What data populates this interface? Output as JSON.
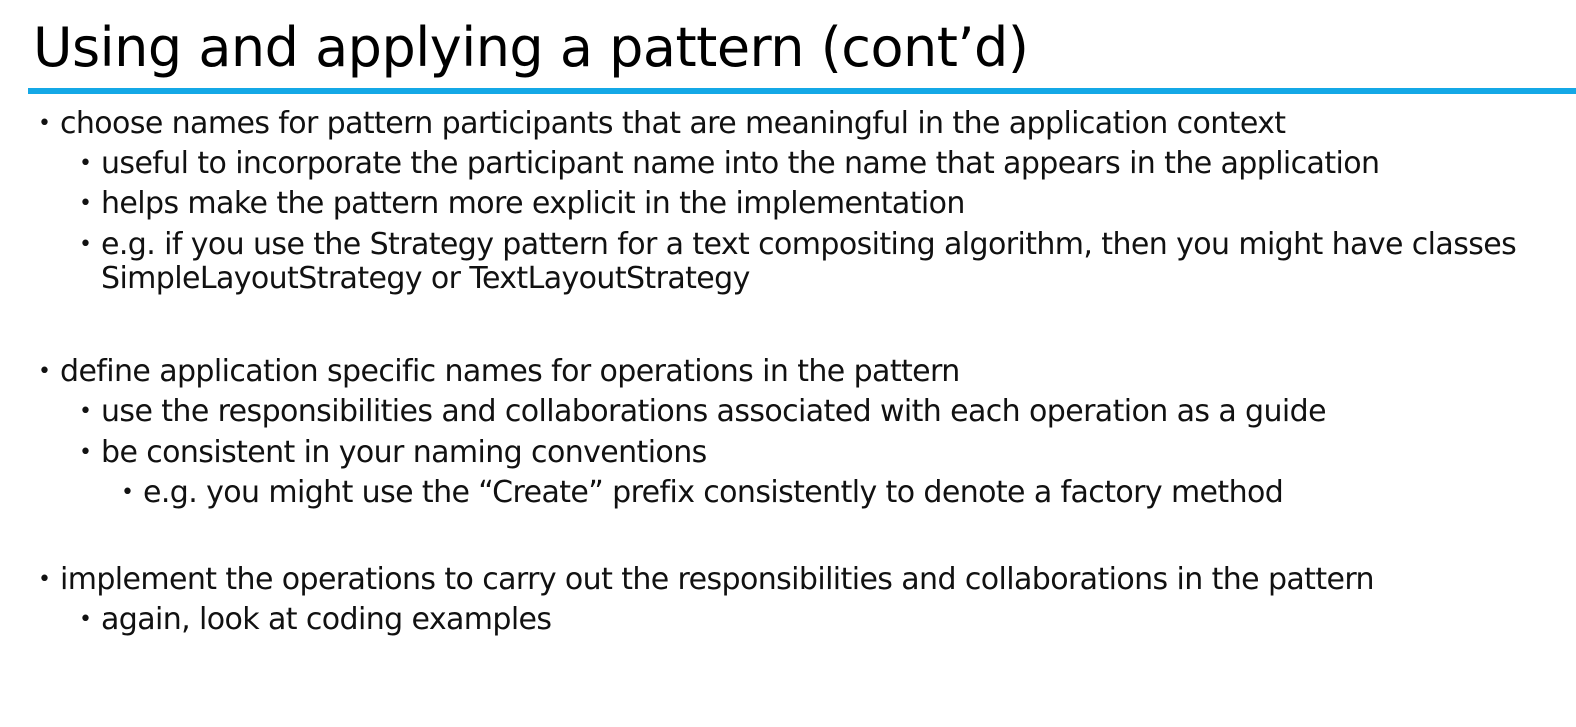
{
  "slide": {
    "title": "Using and applying a pattern (cont’d)",
    "accent_color": "#14a8e6"
  },
  "bullets": {
    "b1": "choose names for pattern participants that are meaningful in the application context",
    "b1_1": "useful to incorporate the participant name into the name that appears in the application",
    "b1_2": "helps make the pattern more explicit in the implementation",
    "b1_3_line1": "e.g.  if you use the Strategy pattern for a text compositing algorithm, then you might have classes",
    "b1_3_line2": "SimpleLayoutStrategy or TextLayoutStrategy",
    "b2": "define application specific names for operations in the pattern",
    "b2_1": "use the responsibilities and collaborations associated with each operation as a guide",
    "b2_2": "be consistent in your naming conventions",
    "b2_2_1": "e.g.  you might use the “Create” prefix consistently to denote a factory method",
    "b3": "implement the operations to carry out the responsibilities and collaborations in the pattern",
    "b3_1": "again, look at coding examples"
  },
  "bullet_glyph": "•"
}
